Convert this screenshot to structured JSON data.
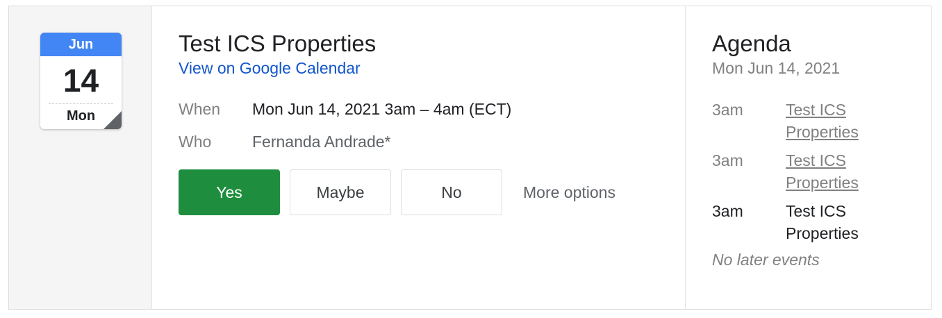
{
  "calendar_icon": {
    "month": "Jun",
    "day": "14",
    "weekday": "Mon"
  },
  "event": {
    "title": "Test ICS Properties",
    "view_link": "View on Google Calendar",
    "when_label": "When",
    "when_value": "Mon Jun 14, 2021 3am – 4am (ECT)",
    "who_label": "Who",
    "who_value": "Fernanda Andrade*"
  },
  "rsvp": {
    "yes": "Yes",
    "maybe": "Maybe",
    "no": "No",
    "more_options": "More options"
  },
  "agenda": {
    "title": "Agenda",
    "date": "Mon Jun 14, 2021",
    "items": [
      {
        "time": "3am",
        "event": "Test ICS Properties"
      },
      {
        "time": "3am",
        "event": "Test ICS Properties"
      },
      {
        "time": "3am",
        "event": "Test ICS Properties"
      }
    ],
    "no_later": "No later events"
  },
  "colors": {
    "accent_blue": "#4285f4",
    "link": "#1155cc",
    "yes_green": "#1e8e3e"
  }
}
